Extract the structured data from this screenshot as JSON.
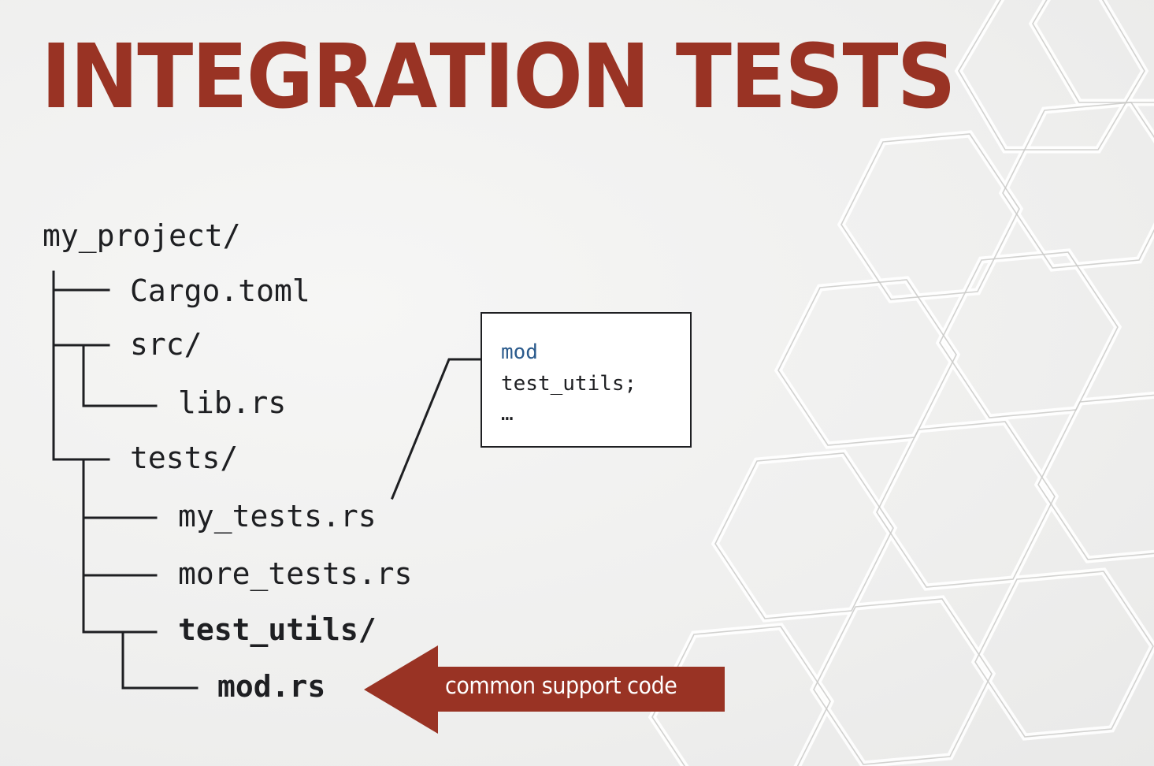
{
  "title": "INTEGRATION TESTS",
  "colors": {
    "accent": "#993324",
    "text": "#1e1f22",
    "keyword": "#2a5a8c",
    "background": "#f0f0ef"
  },
  "tree": {
    "root": "my_project/",
    "cargo_toml": "Cargo.toml",
    "src_dir": "src/",
    "lib_rs": "lib.rs",
    "tests_dir": "tests/",
    "my_tests_rs": "my_tests.rs",
    "more_tests_rs": "more_tests.rs",
    "test_utils_dir": "test_utils/",
    "mod_rs": "mod.rs"
  },
  "code_box": {
    "keyword": "mod",
    "line2": "test_utils;",
    "line3": "…"
  },
  "callout": {
    "label": "common support code"
  }
}
